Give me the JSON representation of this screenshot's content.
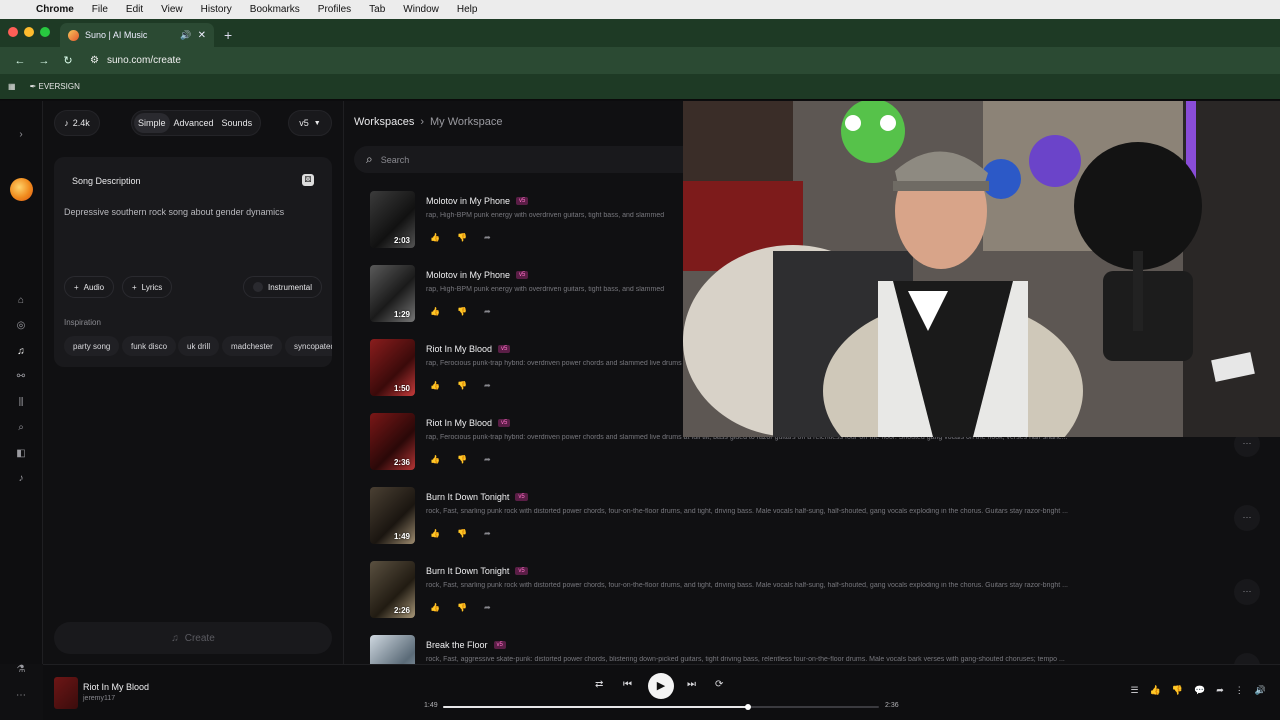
{
  "menubar": {
    "app": "Chrome",
    "items": [
      "File",
      "Edit",
      "View",
      "History",
      "Bookmarks",
      "Profiles",
      "Tab",
      "Window",
      "Help"
    ]
  },
  "browser": {
    "tab_title": "Suno | AI Music",
    "url": "suno.com/create",
    "bookmark": "EVERSIGN"
  },
  "create_panel": {
    "credits": "2.4k",
    "modes": [
      "Simple",
      "Advanced",
      "Sounds"
    ],
    "active_mode": "Simple",
    "model": "v5",
    "song_description_label": "Song Description",
    "song_description_value": "Depressive southern rock song about gender dynamics",
    "audio_label": "Audio",
    "lyrics_label": "Lyrics",
    "instrumental_label": "Instrumental",
    "inspiration_label": "Inspiration",
    "inspiration_tags": [
      "party song",
      "funk disco",
      "uk drill",
      "madchester",
      "syncopated"
    ],
    "create_label": "Create"
  },
  "workspace": {
    "crumb_root": "Workspaces",
    "crumb_current": "My Workspace",
    "search_placeholder": "Search",
    "songs": [
      {
        "title": "Molotov in My Phone",
        "version": "v5",
        "duration": "2:03",
        "desc": "rap, High-BPM punk energy with overdriven guitars, tight bass, and slammed"
      },
      {
        "title": "Molotov in My Phone",
        "version": "v5",
        "duration": "1:29",
        "desc": "rap, High-BPM punk energy with overdriven guitars, tight bass, and slammed"
      },
      {
        "title": "Riot In My Blood",
        "version": "v5",
        "duration": "1:50",
        "desc": "rap, Ferocious punk-trap hybrid: overdriven power chords and slammed live drums at full tilt, bass glued to razor guitars on a relentless four-on-the-floor. Shouted gang vocals on the hook, verses half-snarle..."
      },
      {
        "title": "Riot In My Blood",
        "version": "v5",
        "duration": "2:36",
        "desc": "rap, Ferocious punk-trap hybrid: overdriven power chords and slammed live drums at full tilt, bass glued to razor guitars on a relentless four-on-the-floor. Shouted gang vocals on the hook, verses half-snarle..."
      },
      {
        "title": "Burn It Down Tonight",
        "version": "v5",
        "duration": "1:49",
        "desc": "rock, Fast, snarling punk rock with distorted power chords, four-on-the-floor drums, and tight, driving bass. Male vocals half-sung, half-shouted, gang vocals exploding in the chorus. Guitars stay razor-bright ..."
      },
      {
        "title": "Burn It Down Tonight",
        "version": "v5",
        "duration": "2:26",
        "desc": "rock, Fast, snarling punk rock with distorted power chords, four-on-the-floor drums, and tight, driving bass. Male vocals half-sung, half-shouted, gang vocals exploding in the chorus. Guitars stay razor-bright ..."
      },
      {
        "title": "Break the Floor",
        "version": "v5",
        "duration": "",
        "desc": "rock, Fast, aggressive skate-punk: distorted power chords, blistering down-picked guitars, tight driving bass, relentless four-on-the-floor drums. Male vocals bark verses with gang-shouted choruses; tempo ..."
      }
    ]
  },
  "player": {
    "title": "Riot In My Blood",
    "user": "jeremy117",
    "current_time": "1:49",
    "total_time": "2:36",
    "progress": 0.7
  },
  "colors": {
    "accent_v5": "#ff6fc7",
    "browser_green": "#2b4a33"
  }
}
